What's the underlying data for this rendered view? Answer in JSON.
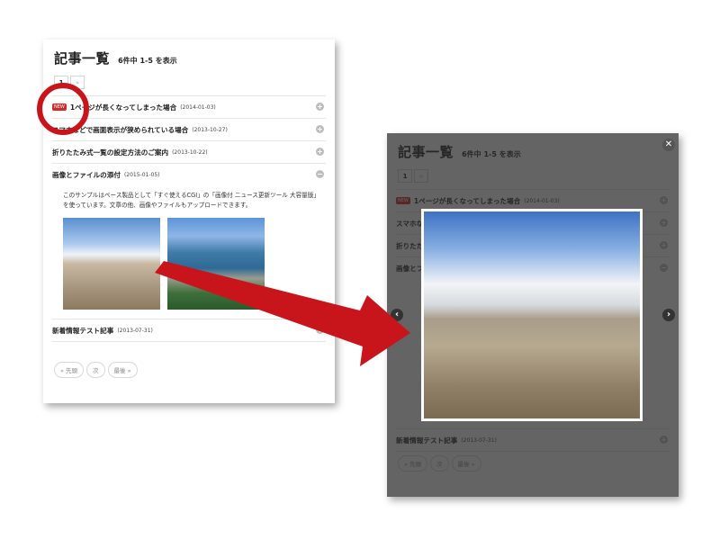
{
  "list": {
    "title": "記事一覧",
    "count_text": "6件中 1-5 を表示",
    "pager": {
      "current": "1",
      "next": "»"
    },
    "new_badge": "NEW",
    "articles": [
      {
        "title": "1ページが長くなってしまった場合",
        "date": "(2014-01-03)",
        "toggle": "+"
      },
      {
        "title": "スマホなどで画面表示が狭められている場合",
        "date": "(2013-10-27)",
        "toggle": "+"
      },
      {
        "title": "折りたたみ式一覧の設定方法のご案内",
        "date": "(2013-10-22)",
        "toggle": "+"
      },
      {
        "title": "画像とファイルの添付",
        "date": "(2015-01-05)",
        "toggle": "−"
      },
      {
        "title": "新着情報テスト記事",
        "date": "(2013-07-31)",
        "toggle": "+"
      }
    ],
    "expanded_body": "このサンプルはベース製品として「すぐ使えるCGI」の「画像付 ニュース更新ツール 大容量版」を使っています。文章の他、画像やファイルもアップロードできます。",
    "bottom_pager": {
      "first": "« 先頭",
      "next": "次",
      "last": "最後 »"
    }
  },
  "lightbox": {
    "close_icon": "close-icon",
    "prev_icon": "chevron-left-icon",
    "next_icon": "chevron-right-icon"
  },
  "colors": {
    "highlight": "#c8151c",
    "arrow": "#c8151c",
    "badge": "#d42a2a"
  }
}
